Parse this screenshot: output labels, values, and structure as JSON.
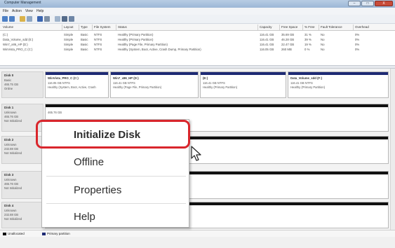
{
  "window": {
    "title": "Computer Management"
  },
  "window_buttons": {
    "minimize": "–",
    "maximize": "□",
    "close": "X"
  },
  "menu": [
    {
      "label": "File"
    },
    {
      "label": "Action"
    },
    {
      "label": "View"
    },
    {
      "label": "Help"
    }
  ],
  "volume_table": {
    "headers": [
      "Volume",
      "Layout",
      "Type",
      "File System",
      "Status",
      "Capacity",
      "Free Space",
      "% Free",
      "Fault Tolerance",
      "Overhead"
    ],
    "rows": [
      [
        "(C:)",
        "Simple",
        "Basic",
        "NTFS",
        "Healthy (Primary Partition)",
        "116.41 GB",
        "35.69 GB",
        "31 %",
        "No",
        "0%"
      ],
      [
        "Data_Volume_sdd (E:)",
        "Simple",
        "Basic",
        "NTFS",
        "Healthy (Primary Partition)",
        "116.41 GB",
        "46.28 GB",
        "39 %",
        "No",
        "0%"
      ],
      [
        "Win7_x86_HP (D:)",
        "Simple",
        "Basic",
        "NTFS",
        "Healthy (Page File, Primary Partition)",
        "116.41 GB",
        "22.47 GB",
        "19 %",
        "No",
        "0%"
      ],
      [
        "WinVista_PRO_C (C:)",
        "Simple",
        "Basic",
        "NTFS",
        "Healthy (System, Boot, Active, Crash Dump, Primary Partition)",
        "116.05 GB",
        "260 MB",
        "0 %",
        "No",
        "0%"
      ]
    ]
  },
  "disks": [
    {
      "name": "Disk 0",
      "lines": [
        "Basic",
        "465.75 GB",
        "Online"
      ],
      "partitions": [
        {
          "title": "WinVista_PRO_C (C:)",
          "lines": [
            "116.05 GB NTFS",
            "Healthy (System, Boot, Active, Crash"
          ]
        },
        {
          "title": "Win7_x86_HP (D:)",
          "lines": [
            "116.41 GB NTFS",
            "Healthy (Page File, Primary Partition)"
          ]
        },
        {
          "title": "(E:)",
          "lines": [
            "116.41 GB NTFS",
            "Healthy (Primary Partition)"
          ]
        },
        {
          "title": "Data_Volume_sdd (F:)",
          "lines": [
            "116.41 GB NTFS",
            "Healthy (Primary Partition)"
          ]
        }
      ]
    },
    {
      "name": "Disk 1",
      "lines": [
        "Unknown",
        "465.76 GB",
        "Not Initialized"
      ],
      "partitions": [
        {
          "title": "",
          "lines": [
            "465.76 GB"
          ]
        }
      ]
    },
    {
      "name": "Disk 2",
      "lines": [
        "Unknown",
        "232.88 GB",
        "Not Initialized"
      ],
      "partitions": []
    },
    {
      "name": "Disk 3",
      "lines": [
        "Unknown",
        "465.76 GB",
        "Not Initialized"
      ],
      "partitions": []
    },
    {
      "name": "Disk 4",
      "lines": [
        "Unknown",
        "232.88 GB",
        "Not Initialized"
      ],
      "partitions": []
    }
  ],
  "legend": [
    {
      "label": "Unallocated",
      "color": "#111111"
    },
    {
      "label": "Primary partition",
      "color": "#1e2a74"
    }
  ],
  "context_menu": {
    "items": [
      {
        "label": "Initialize Disk"
      },
      {
        "label": "Offline"
      },
      {
        "label": "Properties"
      },
      {
        "label": "Help"
      }
    ]
  },
  "colors": {
    "highlight": "#d9262c",
    "primary_partition": "#1e2a74",
    "unallocated": "#111111"
  }
}
